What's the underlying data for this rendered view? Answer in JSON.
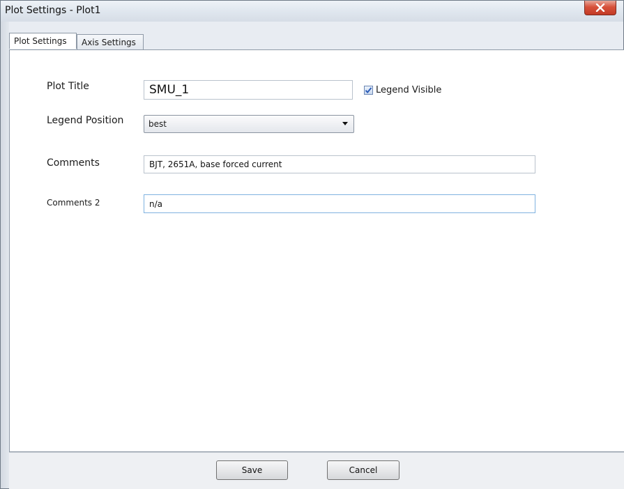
{
  "window": {
    "title": "Plot Settings - Plot1",
    "close_glyph": "X"
  },
  "tabs": [
    {
      "label": "Plot Settings",
      "active": true
    },
    {
      "label": "Axis Settings",
      "active": false
    }
  ],
  "form": {
    "plot_title_label": "Plot Title",
    "plot_title_value": "SMU_1",
    "legend_visible_label": "Legend Visible",
    "legend_visible_checked": true,
    "legend_position_label": "Legend Position",
    "legend_position_value": "best",
    "comments_label": "Comments",
    "comments_value": "BJT, 2651A, base forced current",
    "comments2_label": "Comments 2",
    "comments2_value": "n/a"
  },
  "buttons": {
    "save_label": "Save",
    "cancel_label": "Cancel"
  },
  "colors": {
    "close_button": "#c7422c",
    "checkbox_check": "#2b5cb8",
    "focused_border": "#7fb2e0"
  },
  "icons": {
    "close": "close-icon",
    "dropdown": "chevron-down-icon",
    "check": "checkmark-icon"
  }
}
